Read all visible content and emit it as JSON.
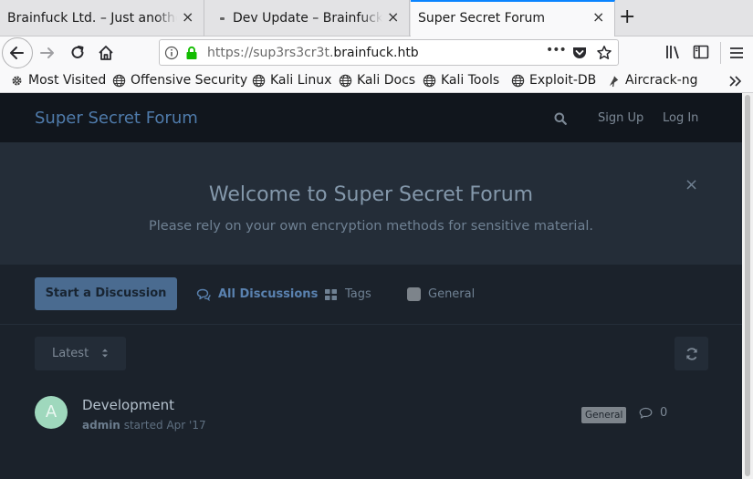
{
  "browser": {
    "tabs": [
      {
        "title": "Brainfuck Ltd. – Just another",
        "close": "×"
      },
      {
        "title": "Dev Update – Brainfuck L",
        "close": "×"
      },
      {
        "title": "Super Secret Forum",
        "close": "×"
      }
    ],
    "new_tab": "+",
    "url": {
      "protocol": "https://",
      "subdomain": "sup3rs3cr3t.",
      "host": "brainfuck.htb"
    },
    "url_menu": "•••"
  },
  "bookmarks": [
    {
      "label": "Most Visited",
      "icon": "gear-icon"
    },
    {
      "label": "Offensive Security",
      "icon": "globe-icon"
    },
    {
      "label": "Kali Linux",
      "icon": "globe-icon"
    },
    {
      "label": "Kali Docs",
      "icon": "globe-icon"
    },
    {
      "label": "Kali Tools",
      "icon": "globe-icon"
    },
    {
      "label": "Exploit-DB",
      "icon": "globe-icon"
    },
    {
      "label": "Aircrack-ng",
      "icon": "antenna-icon"
    }
  ],
  "forum": {
    "title": "Super Secret Forum",
    "header": {
      "sign_up": "Sign Up",
      "log_in": "Log In"
    },
    "hero": {
      "title": "Welcome to Super Secret Forum",
      "subtitle": "Please rely on your own encryption methods for sensitive material.",
      "close": "×"
    },
    "start_button": "Start a Discussion",
    "nav": {
      "all_discussions": "All Discussions",
      "tags": "Tags",
      "general": "General"
    },
    "sort": {
      "selected": "Latest"
    },
    "discussions": [
      {
        "avatar_letter": "A",
        "title": "Development",
        "author": "admin",
        "started": "started Apr '17",
        "tag": "General",
        "replies": "0"
      }
    ]
  },
  "colors": {
    "accent": "#4a6b90",
    "link_blue": "#5a82b0",
    "page_bg": "#1b222b",
    "header_bg": "#11161d",
    "hero_bg": "#242d38",
    "tag_general": "#7d848b",
    "avatar_bg": "#9fd8bd",
    "tab_accent": "#0a84ff"
  }
}
